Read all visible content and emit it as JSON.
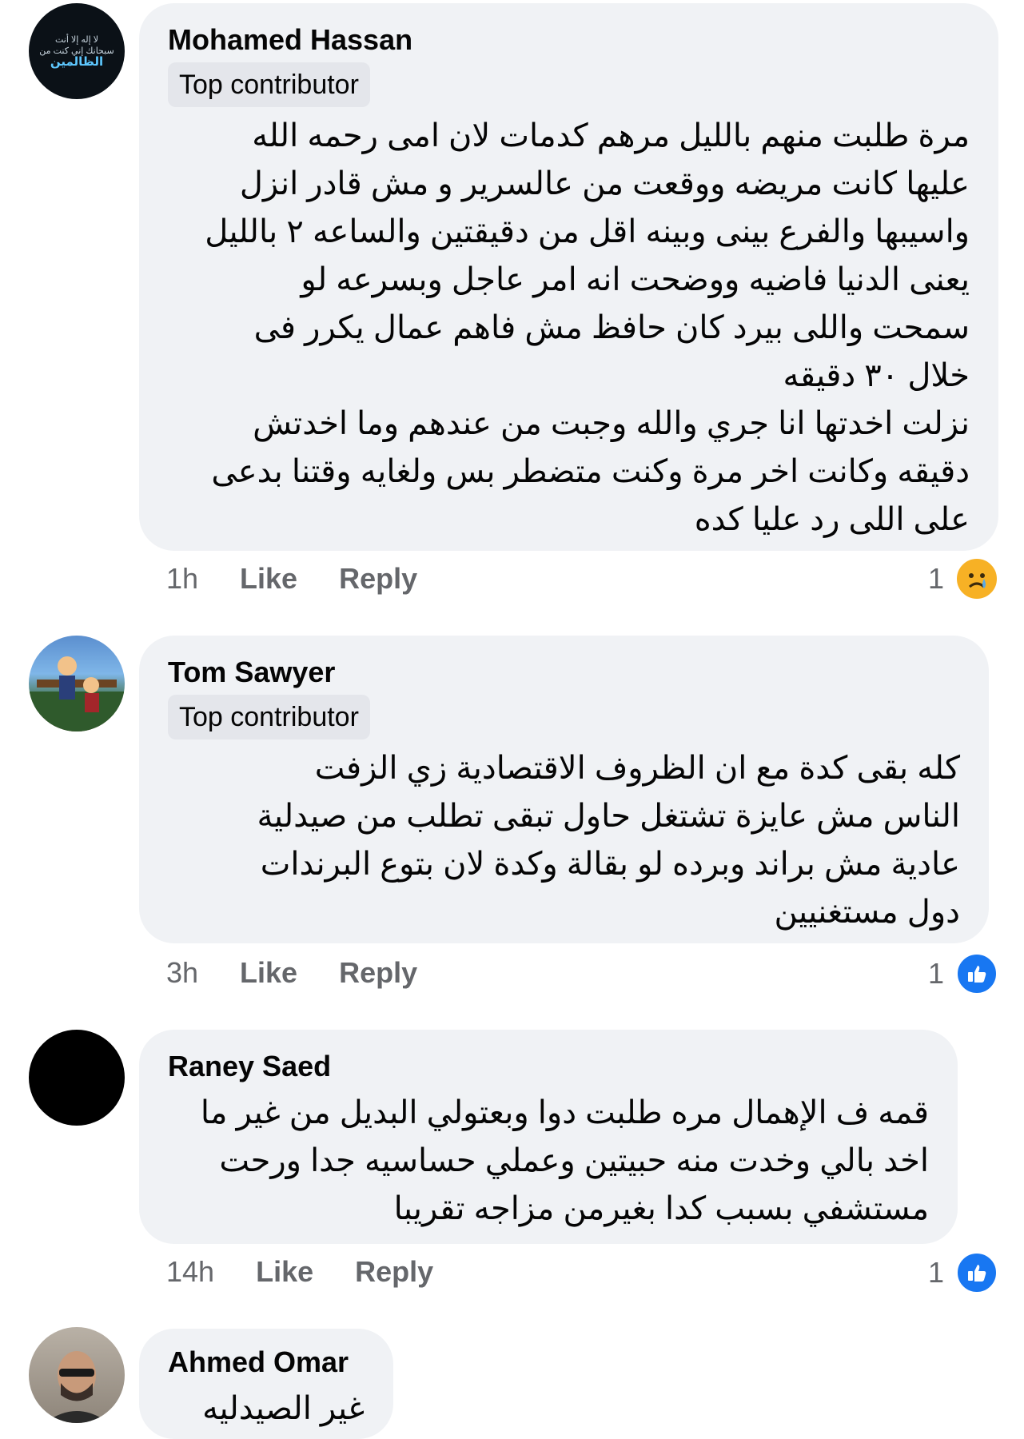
{
  "comments": [
    {
      "author": "Mohamed Hassan",
      "badge": "Top contributor",
      "avatar_text": [
        "لا إله إلا أنت",
        "سبحانك إني كنت من",
        "الظالمين"
      ],
      "text": "مرة طلبت منهم بالليل مرهم كدمات لان امى رحمه الله\nعليها كانت مريضه ووقعت من عالسرير و مش قادر انزل\nواسيبها والفرع بينى وبينه اقل من دقيقتين والساعه ٢ بالليل\nيعنى الدنيا فاضيه ووضحت انه امر عاجل وبسرعه لو\nسمحت واللى بيرد كان حافظ مش فاهم عمال يكرر فى\nخلال ٣٠ دقيقه\nنزلت اخدتها انا جري والله وجبت من عندهم وما اخدتش\nدقيقه وكانت اخر مرة وكنت متضطر بس ولغايه وقتنا بدعى\nعلى اللى رد عليا كده",
      "time": "1h",
      "like_label": "Like",
      "reply_label": "Reply",
      "reaction_count": "1",
      "reaction_icon": "sad-face-icon"
    },
    {
      "author": "Tom Sawyer",
      "badge": "Top contributor",
      "text": "كله  بقى  كدة    مع ان الظروف الاقتصادية  زي الزفت\nالناس مش عايزة  تشتغل     حاول تبقى تطلب من صيدلية\nعادية مش براند   وبرده  لو بقالة وكدة    لان بتوع البرندات\nدول مستغنيين",
      "time": "3h",
      "like_label": "Like",
      "reply_label": "Reply",
      "reaction_count": "1",
      "reaction_icon": "thumbs-up-icon"
    },
    {
      "author": "Raney Saed",
      "text": "قمه ف الإهمال مره طلبت دوا وبعتولي البديل من غير ما\nاخد بالي وخدت منه حبيتين وعملي حساسيه جدا ورحت\nمستشفي بسبب كدا بغيرمن مزاجه تقريبا",
      "time": "14h",
      "like_label": "Like",
      "reply_label": "Reply",
      "reaction_count": "1",
      "reaction_icon": "thumbs-up-icon"
    },
    {
      "author": "Ahmed Omar",
      "text": "غير الصيدليه"
    }
  ],
  "colors": {
    "bubble": "#f0f2f5",
    "badge": "#e4e6eb",
    "meta": "#65676b",
    "like_blue": "#1877f2",
    "sad_yellow": "#f7b125"
  }
}
